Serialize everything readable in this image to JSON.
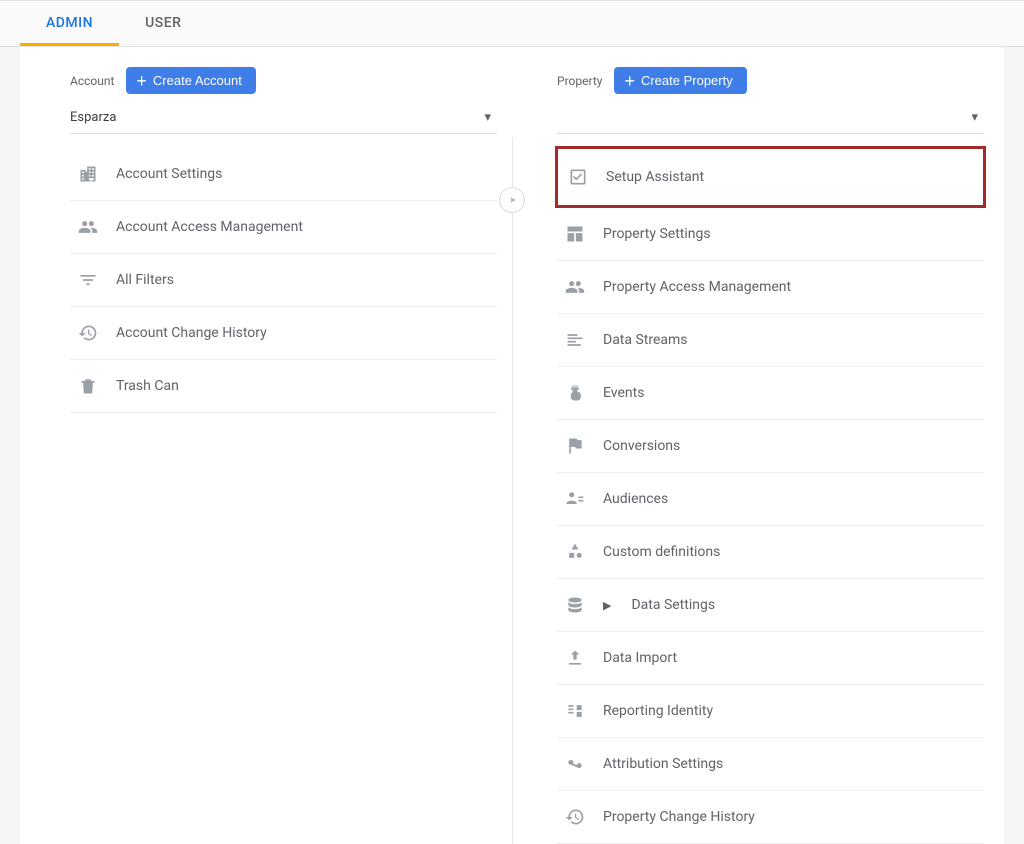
{
  "tabs": {
    "admin": "ADMIN",
    "user": "USER"
  },
  "account": {
    "label": "Account",
    "create": "Create Account",
    "selected": "Esparza",
    "items": [
      {
        "label": "Account Settings"
      },
      {
        "label": "Account Access Management"
      },
      {
        "label": "All Filters"
      },
      {
        "label": "Account Change History"
      },
      {
        "label": "Trash Can"
      }
    ]
  },
  "property": {
    "label": "Property",
    "create": "Create Property",
    "selected": "",
    "items": [
      {
        "label": "Setup Assistant"
      },
      {
        "label": "Property Settings"
      },
      {
        "label": "Property Access Management"
      },
      {
        "label": "Data Streams"
      },
      {
        "label": "Events"
      },
      {
        "label": "Conversions"
      },
      {
        "label": "Audiences"
      },
      {
        "label": "Custom definitions"
      },
      {
        "label": "Data Settings",
        "expandable": true
      },
      {
        "label": "Data Import"
      },
      {
        "label": "Reporting Identity"
      },
      {
        "label": "Attribution Settings"
      },
      {
        "label": "Property Change History"
      }
    ]
  }
}
